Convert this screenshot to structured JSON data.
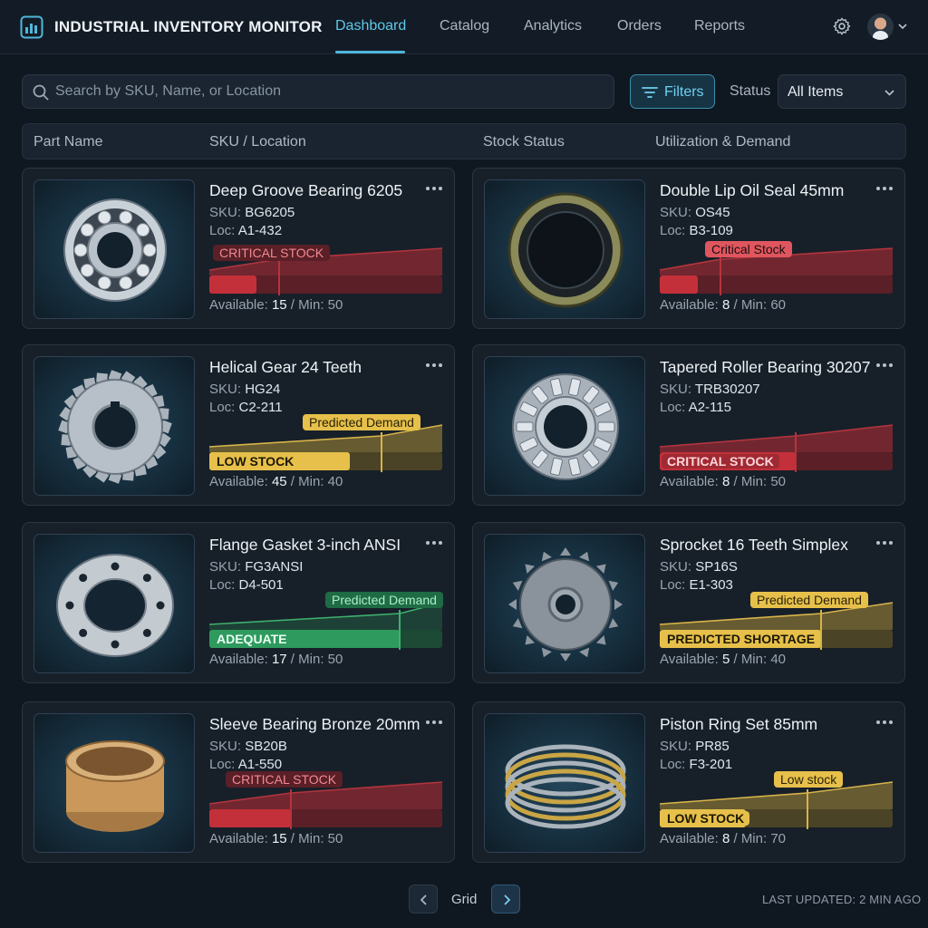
{
  "app": {
    "title": "INDUSTRIAL INVENTORY MONITOR",
    "nav": [
      "Dashboard",
      "Catalog",
      "Analytics",
      "Orders",
      "Reports"
    ],
    "active_tab": "Dashboard"
  },
  "toolbar": {
    "search_placeholder": "Search by SKU, Name, or Location",
    "filters_label": "Filters",
    "status_label": "Status",
    "status_value": "All Items"
  },
  "columns": [
    "Part Name",
    "SKU / Location",
    "Stock Status",
    "Utilization & Demand"
  ],
  "colors": {
    "critical": "#c4303a",
    "low": "#e6c04a",
    "adequate": "#2f9a5e",
    "accent": "#4fb7db"
  },
  "items": [
    {
      "name": "Deep Groove Bearing 6205",
      "sku_label": "SKU:",
      "sku": "BG6205",
      "loc_label": "Loc:",
      "loc": "A1-432",
      "status": "critical",
      "tag": "CRITICAL STOCK",
      "bar_label": "",
      "available": "15",
      "min": "50",
      "avail_label": "Available:",
      "min_label": "Min:",
      "icon": "ball-bearing"
    },
    {
      "name": "Double Lip Oil Seal 45mm",
      "sku_label": "SKU:",
      "sku": "OS45",
      "loc_label": "Loc:",
      "loc": "B3-109",
      "status": "critical",
      "tag": "Critical Stock",
      "bar_label": "",
      "available": "8",
      "min": "60",
      "avail_label": "Available:",
      "min_label": "Min:",
      "icon": "oil-seal"
    },
    {
      "name": "Helical Gear 24 Teeth",
      "sku_label": "SKU:",
      "sku": "HG24",
      "loc_label": "Loc:",
      "loc": "C2-211",
      "status": "low",
      "tag": "Predicted Demand",
      "bar_label": "LOW STOCK",
      "available": "45",
      "min": "40",
      "avail_label": "Available:",
      "min_label": "Min:",
      "icon": "helical-gear"
    },
    {
      "name": "Tapered Roller Bearing 30207",
      "sku_label": "SKU:",
      "sku": "TRB30207",
      "loc_label": "Loc:",
      "loc": "A2-115",
      "status": "critical",
      "tag": "",
      "bar_label": "CRITICAL STOCK",
      "available": "8",
      "min": "50",
      "avail_label": "Available:",
      "min_label": "Min:",
      "icon": "tapered-roller-bearing"
    },
    {
      "name": "Flange Gasket 3-inch ANSI",
      "sku_label": "SKU:",
      "sku": "FG3ANSI",
      "loc_label": "Loc:",
      "loc": "D4-501",
      "status": "adequate",
      "tag": "Predicted Demand",
      "bar_label": "ADEQUATE",
      "available": "17",
      "min": "50",
      "avail_label": "Available:",
      "min_label": "Min:",
      "icon": "flange-gasket"
    },
    {
      "name": "Sprocket 16 Teeth Simplex",
      "sku_label": "SKU:",
      "sku": "SP16S",
      "loc_label": "Loc:",
      "loc": "E1-303",
      "status": "low",
      "tag": "Predicted Demand",
      "bar_label": "PREDICTED SHORTAGE",
      "available": "5",
      "min": "40",
      "avail_label": "Available:",
      "min_label": "Min:",
      "icon": "sprocket"
    },
    {
      "name": "Sleeve Bearing Bronze 20mm",
      "sku_label": "SKU:",
      "sku": "SB20B",
      "loc_label": "Loc:",
      "loc": "A1-550",
      "status": "critical",
      "tag": "CRITICAL STOCK",
      "bar_label": "",
      "available": "15",
      "min": "50",
      "avail_label": "Available:",
      "min_label": "Min:",
      "icon": "sleeve-bearing"
    },
    {
      "name": "Piston Ring Set 85mm",
      "sku_label": "SKU:",
      "sku": "PR85",
      "loc_label": "Loc:",
      "loc": "F3-201",
      "status": "low",
      "tag": "Low stock",
      "bar_label": "LOW STOCK",
      "available": "8",
      "min": "70",
      "avail_label": "Available:",
      "min_label": "Min:",
      "icon": "piston-rings"
    }
  ],
  "footer": {
    "view_label": "Grid",
    "updated": "LAST UPDATED: 2 MIN AGO"
  }
}
